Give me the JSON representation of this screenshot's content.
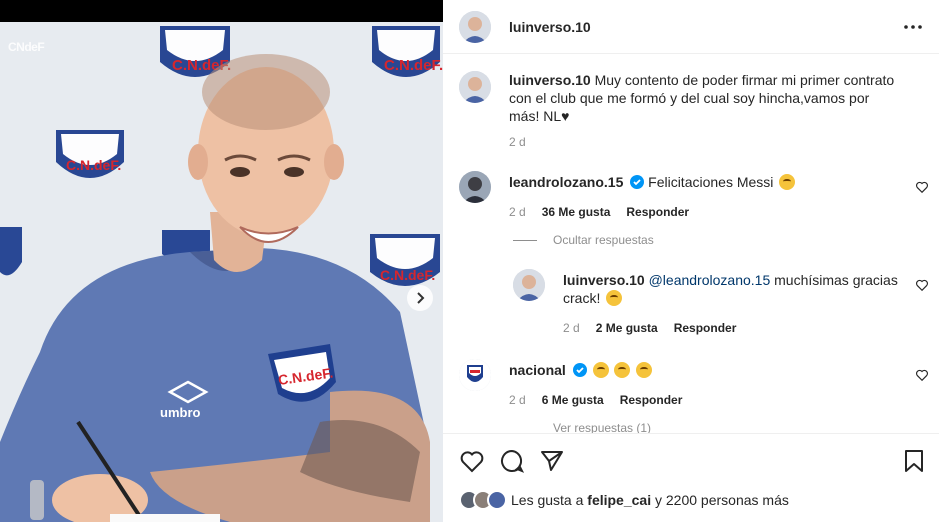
{
  "post": {
    "author": "luinverso.10",
    "watermark": "CNdeF",
    "caption_text": "Muy contento de poder firmar mi primer contrato con el club que me formó y del cual soy hincha,vamos por más! NL♥",
    "caption_time": "2 d",
    "photo_logo_text": "C.N.deF.",
    "shirt_brand": "umbro"
  },
  "comments": [
    {
      "user": "leandrolozano.15",
      "text": "Felicitaciones Messi",
      "time": "2 d",
      "likes": "36 Me gusta",
      "reply_label": "Responder",
      "verified": true
    },
    {
      "user": "nacional",
      "text": "",
      "time": "2 d",
      "likes": "6 Me gusta",
      "reply_label": "Responder",
      "verified": true
    }
  ],
  "reply": {
    "user": "luinverso.10",
    "mention": "@leandrolozano.15",
    "text": "muchísimas gracias crack!",
    "time": "2 d",
    "likes": "2 Me gusta",
    "reply_label": "Responder"
  },
  "hide_replies_label": "Ocultar respuestas",
  "view_replies_label": "Ver respuestas (1)",
  "likes_summary": {
    "prefix": "Les gusta a",
    "user": "felipe_cai",
    "suffix": "y 2200 personas más"
  },
  "icons": {
    "like": "heart-icon",
    "comment": "comment-icon",
    "share": "send-icon",
    "save": "bookmark-icon",
    "more": "more-options-icon",
    "next": "chevron-right-icon"
  },
  "colors": {
    "verified": "#0095f6",
    "club_blue": "#1f3f8f",
    "club_red": "#d6262e"
  }
}
